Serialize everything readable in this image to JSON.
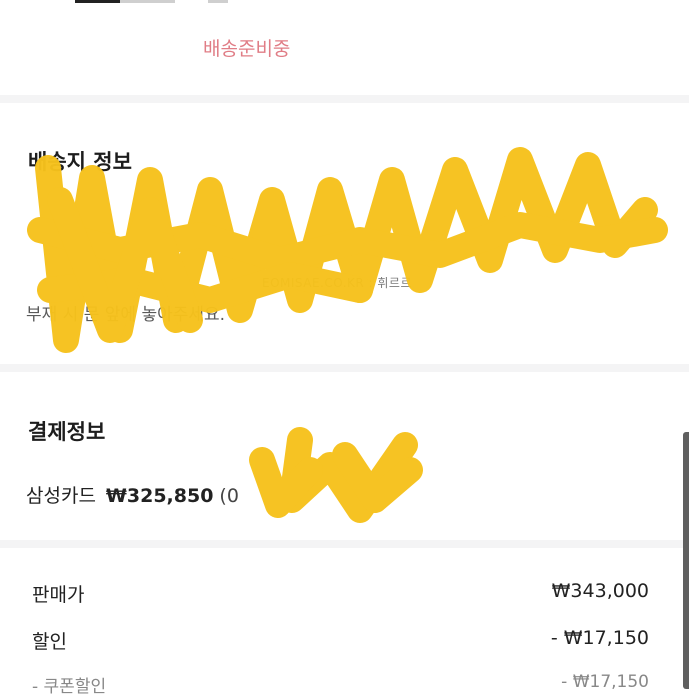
{
  "order": {
    "status_label": "배송준비중"
  },
  "shipping": {
    "title": "배송지 정보",
    "lines": [
      "",
      "",
      "",
      "부재 시 문 앞에 놓아주세요."
    ]
  },
  "watermark": {
    "text": "EOMISAE.CO.KR : 휘르르"
  },
  "payment": {
    "title": "결제정보",
    "method": "삼성카드",
    "amount": "₩325,850",
    "extra": "(0"
  },
  "summary": {
    "rows": [
      {
        "label": "판매가",
        "value": "₩343,000"
      },
      {
        "label": "할인",
        "value": "- ₩17,150"
      },
      {
        "label": "- 쿠폰할인",
        "value": "- ₩17,150"
      }
    ]
  },
  "colors": {
    "status": "#e07d86",
    "redaction": "#f6c21c"
  }
}
